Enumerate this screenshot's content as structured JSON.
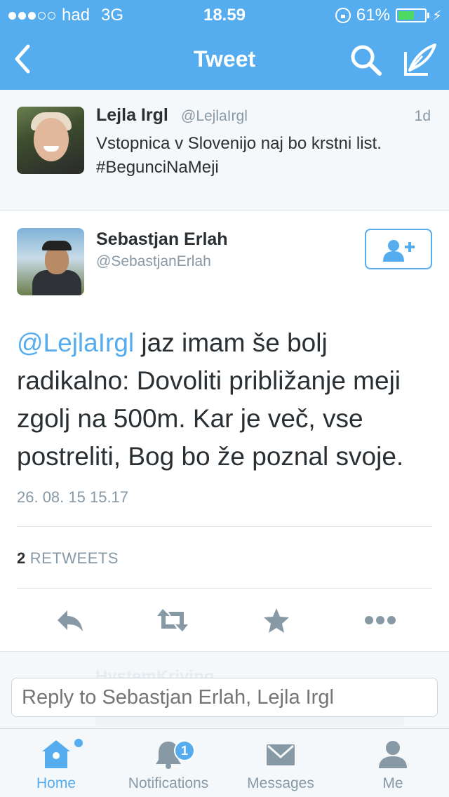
{
  "status_bar": {
    "carrier": "had",
    "network": "3G",
    "time": "18.59",
    "battery": "61%",
    "battery_level": 0.61
  },
  "nav": {
    "title": "Tweet",
    "icons": [
      "back-chevron-icon",
      "search-icon",
      "compose-tweet-icon"
    ]
  },
  "parent_tweet": {
    "name": "Lejla Irgl",
    "handle": "@LejlaIrgl",
    "age": "1d",
    "text": "Vstopnica v Slovenijo naj bo krstni list. #BegunciNaMeji"
  },
  "tweet": {
    "name": "Sebastjan Erlah",
    "handle": "@SebastjanErlah",
    "mention": "@LejlaIrgl",
    "text": " jaz imam še bolj radikalno: Dovoliti približanje meji zgolj na 500m. Kar je več, vse postreliti, Bog bo že poznal svoje.",
    "date": "26. 08. 15 15.17",
    "retweet_count": "2",
    "retweet_label": "RETWEETS",
    "follow_icon": "add-user-icon"
  },
  "actions": [
    "reply-icon",
    "retweet-icon",
    "favorite-icon",
    "more-icon"
  ],
  "reply": {
    "background_name": "HystemKriving",
    "placeholder": "Reply to Sebastjan Erlah, Lejla Irgl"
  },
  "tabs": [
    {
      "label": "Home",
      "icon": "home-icon",
      "active": true
    },
    {
      "label": "Notifications",
      "icon": "bell-icon",
      "badge": "1"
    },
    {
      "label": "Messages",
      "icon": "envelope-icon"
    },
    {
      "label": "Me",
      "icon": "person-icon"
    }
  ],
  "colors": {
    "accent": "#55acee",
    "text": "#292f33",
    "muted": "#8899a6",
    "battery_green": "#4cd964"
  }
}
